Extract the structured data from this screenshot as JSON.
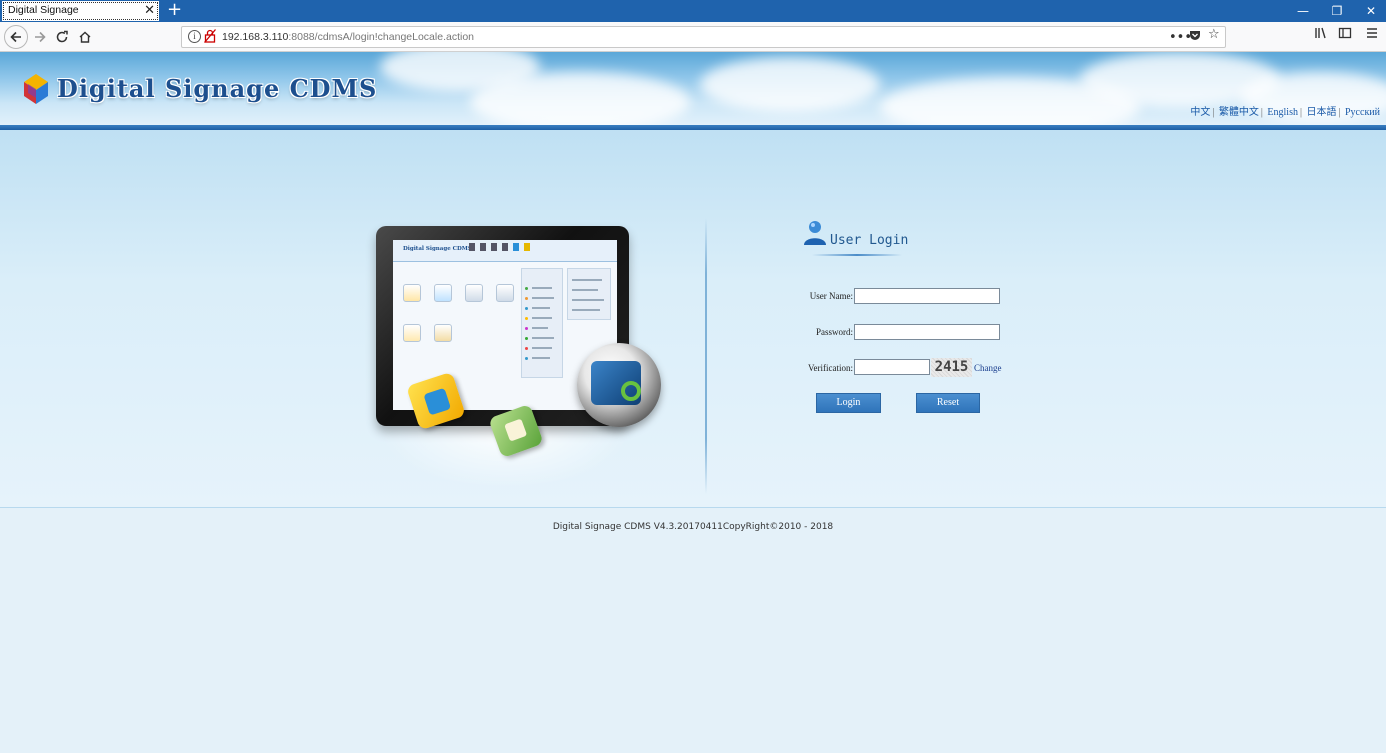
{
  "browser": {
    "tab_title": "Digital Signage",
    "tab_close": "✕",
    "new_tab": "+",
    "url_host": "192.168.3.110",
    "url_rest": ":8088/cdmsA/login!changeLocale.action",
    "window_controls": {
      "minimize": "—",
      "restore": "❐",
      "close": "✕"
    },
    "icons": {
      "back": "back-arrow-icon",
      "forward": "forward-arrow-icon",
      "reload": "reload-icon",
      "home": "home-icon",
      "more": "more-dots-icon",
      "pocket": "pocket-icon",
      "bookmark": "star-icon",
      "library": "library-icon",
      "sidebar": "sidebar-icon",
      "menu": "hamburger-menu-icon"
    }
  },
  "header": {
    "brand": "Digital Signage CDMS",
    "languages": [
      "中文",
      "繁體中文",
      "English",
      "日本語",
      "Русский"
    ]
  },
  "tablet_screen": {
    "brand": "Digital Signage CDMS"
  },
  "login": {
    "title": "User Login",
    "username_label": "User Name:",
    "username_value": "",
    "password_label": "Password:",
    "password_value": "",
    "verification_label": "Verification:",
    "verification_value": "",
    "captcha": "2415",
    "change_link": "Change",
    "login_button": "Login",
    "reset_button": "Reset"
  },
  "footer": {
    "text": "Digital Signage CDMS V4.3.20170411CopyRight©2010 - 2018"
  },
  "colors": {
    "browser_tabbar": "#1f63ad",
    "brand_text": "#1d4f8e",
    "button": "#3a82c6",
    "page_bg": "#e4f1f9"
  }
}
